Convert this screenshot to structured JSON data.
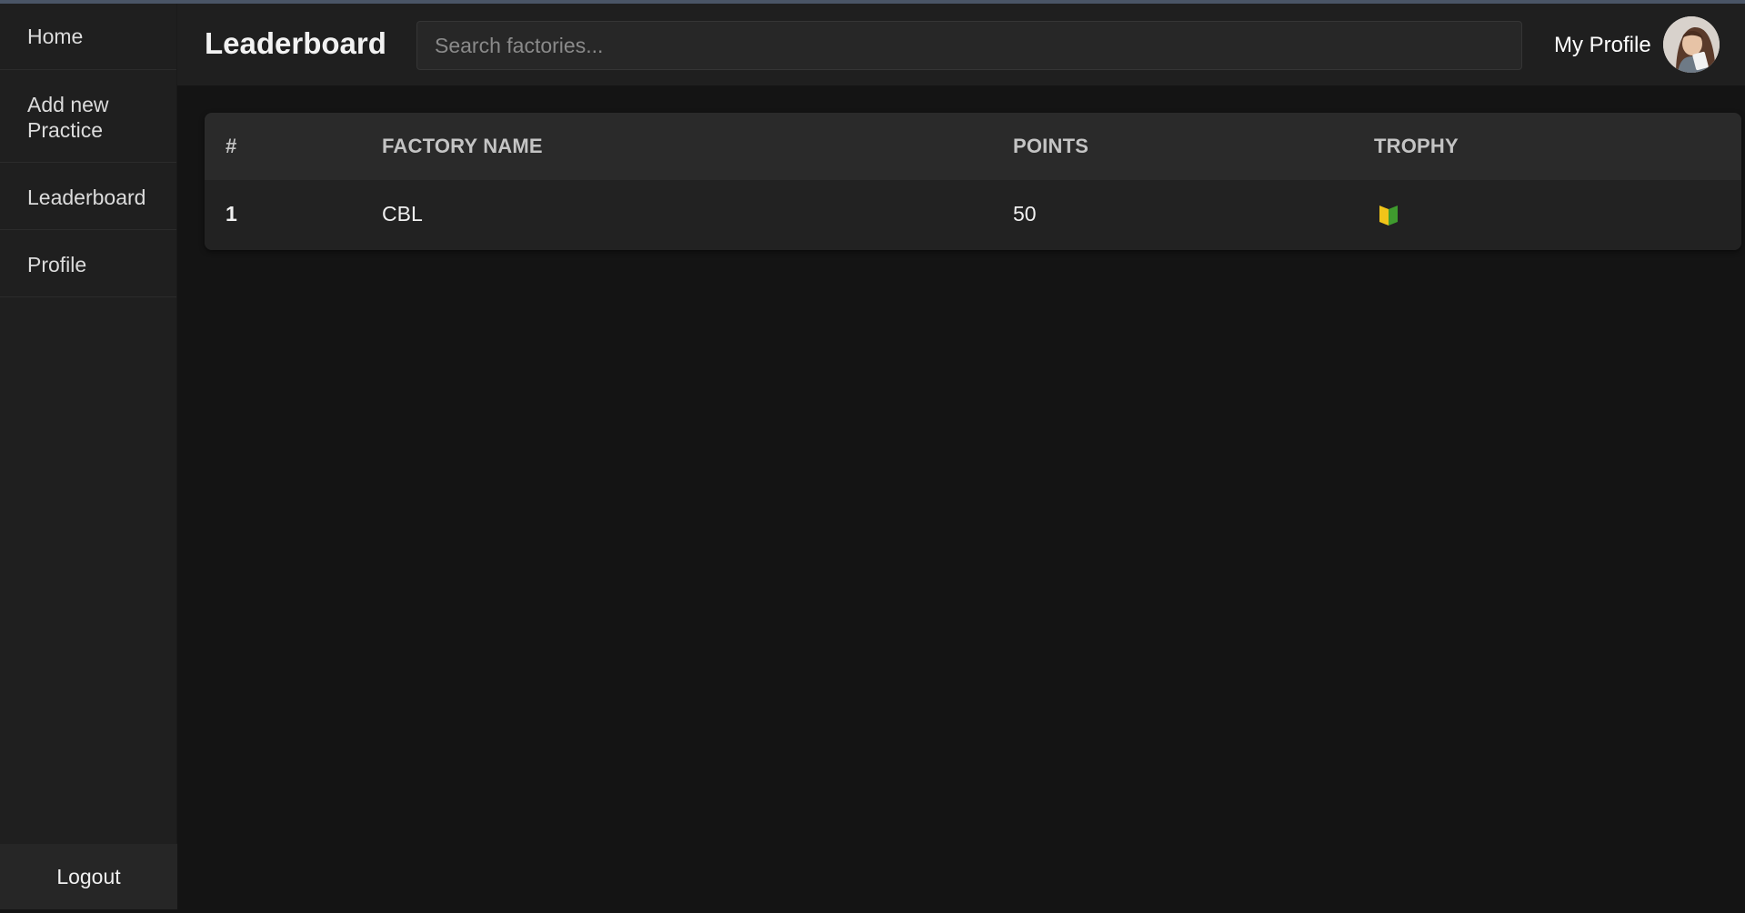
{
  "sidebar": {
    "items": [
      {
        "label": "Home"
      },
      {
        "label": "Add new Practice"
      },
      {
        "label": "Leaderboard"
      },
      {
        "label": "Profile"
      }
    ],
    "logout_label": "Logout"
  },
  "header": {
    "title": "Leaderboard",
    "search_placeholder": "Search factories...",
    "profile_label": "My Profile",
    "avatar_icon": "user-avatar-icon"
  },
  "leaderboard": {
    "columns": [
      "#",
      "FACTORY NAME",
      "POINTS",
      "TROPHY"
    ],
    "rows": [
      {
        "rank": "1",
        "factory_name": "CBL",
        "points": "50",
        "trophy_icon": "beginner-badge-icon"
      }
    ]
  },
  "colors": {
    "background": "#141414",
    "sidebar": "#1f1f1f",
    "table_header": "#2a2a2a",
    "trophy_yellow": "#f0c419",
    "trophy_green": "#3f9b2e"
  }
}
